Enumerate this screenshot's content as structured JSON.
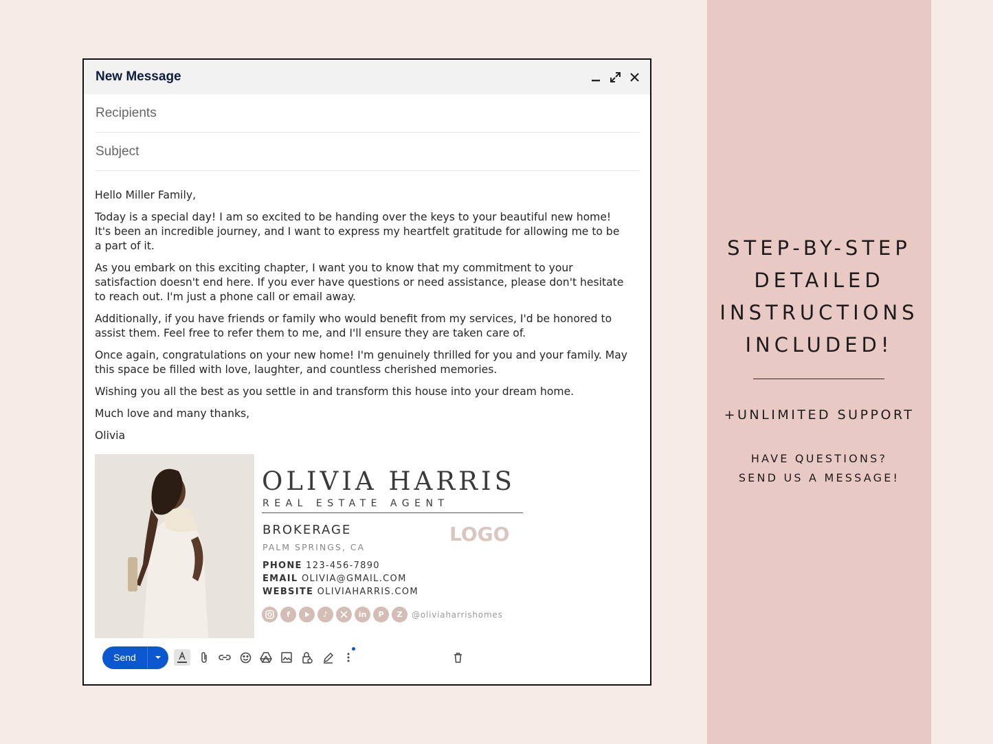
{
  "compose": {
    "title": "New Message",
    "recipients_placeholder": "Recipients",
    "subject_placeholder": "Subject",
    "body": {
      "greeting": "Hello Miller Family,",
      "p1": "Today is a special day! I am so excited to be handing over the keys to your beautiful new home! It's been an incredible journey, and I want to express my heartfelt gratitude for allowing me to be a part of it.",
      "p2": "As you embark on this exciting chapter, I want you to know that my commitment to your satisfaction doesn't end here. If you ever have questions or need assistance, please don't hesitate to reach out. I'm just a phone call or email away.",
      "p3": "Additionally, if you have friends or family who would benefit from my services, I'd be honored to assist them. Feel free to refer them to me, and I'll ensure they are taken care of.",
      "p4": "Once again, congratulations on your new home! I'm genuinely thrilled for you and your family. May this space be filled with love, laughter, and countless cherished memories.",
      "p5": "Wishing you all the best as you settle in and transform this house into your dream home.",
      "closing": "Much love and many thanks,",
      "sender": "Olivia"
    },
    "signature": {
      "name": "OLIVIA HARRIS",
      "role": "REAL ESTATE AGENT",
      "brokerage": "BROKERAGE",
      "location": "PALM SPRINGS, CA",
      "logo": "LOGO",
      "phone_label": "PHONE",
      "phone": "123-456-7890",
      "email_label": "EMAIL",
      "email": "OLIVIA@GMAIL.COM",
      "website_label": "WEBSITE",
      "website": "OLIVIAHARRIS.COM",
      "social_handle": "@oliviaharrishomes",
      "social_icons": [
        "instagram-icon",
        "facebook-icon",
        "youtube-icon",
        "tiktok-icon",
        "x-icon",
        "linkedin-icon",
        "pinterest-icon",
        "zillow-icon"
      ]
    },
    "toolbar": {
      "send_label": "Send"
    }
  },
  "panel": {
    "heading_lines": [
      "STEP-BY-STEP",
      "DETAILED",
      "INSTRUCTIONS",
      "INCLUDED!"
    ],
    "support": "+UNLIMITED SUPPORT",
    "questions_line1": "HAVE QUESTIONS?",
    "questions_line2": "SEND US A MESSAGE!"
  },
  "colors": {
    "page_bg": "#f7ebe8",
    "panel_bg": "#e9c9c3",
    "send_button": "#0b57d0",
    "social_icon": "#d4bdb4"
  }
}
